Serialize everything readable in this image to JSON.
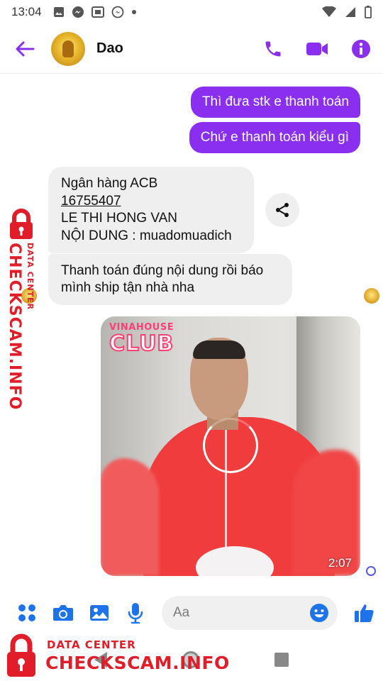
{
  "status_bar": {
    "time": "13:04",
    "icons": [
      "image-icon",
      "messenger-icon",
      "gallery-icon",
      "messenger-icon",
      "dot-icon",
      "wifi-icon",
      "signal-icon",
      "battery-icon"
    ]
  },
  "header": {
    "contact_name": "Dao",
    "actions": [
      "phone-icon",
      "video-call-icon",
      "info-icon"
    ],
    "accent_color": "#8a2ff0"
  },
  "messages": {
    "outgoing": [
      "Thì đưa stk e thanh toán",
      "Chứ e thanh toán kiểu gì"
    ],
    "incoming_bank": {
      "line1": "Ngân hàng ACB",
      "account_number": "16755407",
      "line3": "LE THI HONG VAN",
      "line4": "NỘI DUNG : muadomuadich"
    },
    "incoming_note": "Thanh toán đúng nội dung rồi báo mình ship tận nhà nha",
    "video": {
      "logo_line1": "VINAHOUSE",
      "logo_line2": "CLUB",
      "duration": "2:07"
    }
  },
  "composer": {
    "placeholder": "Aa",
    "icons": [
      "apps-icon",
      "camera-icon",
      "gallery-icon",
      "mic-icon",
      "emoji-icon",
      "thumbs-up-icon"
    ]
  },
  "watermark": {
    "sub": "DATA CENTER",
    "brand": "CHECKSCAM.INFO",
    "color": "#e11d2a"
  }
}
